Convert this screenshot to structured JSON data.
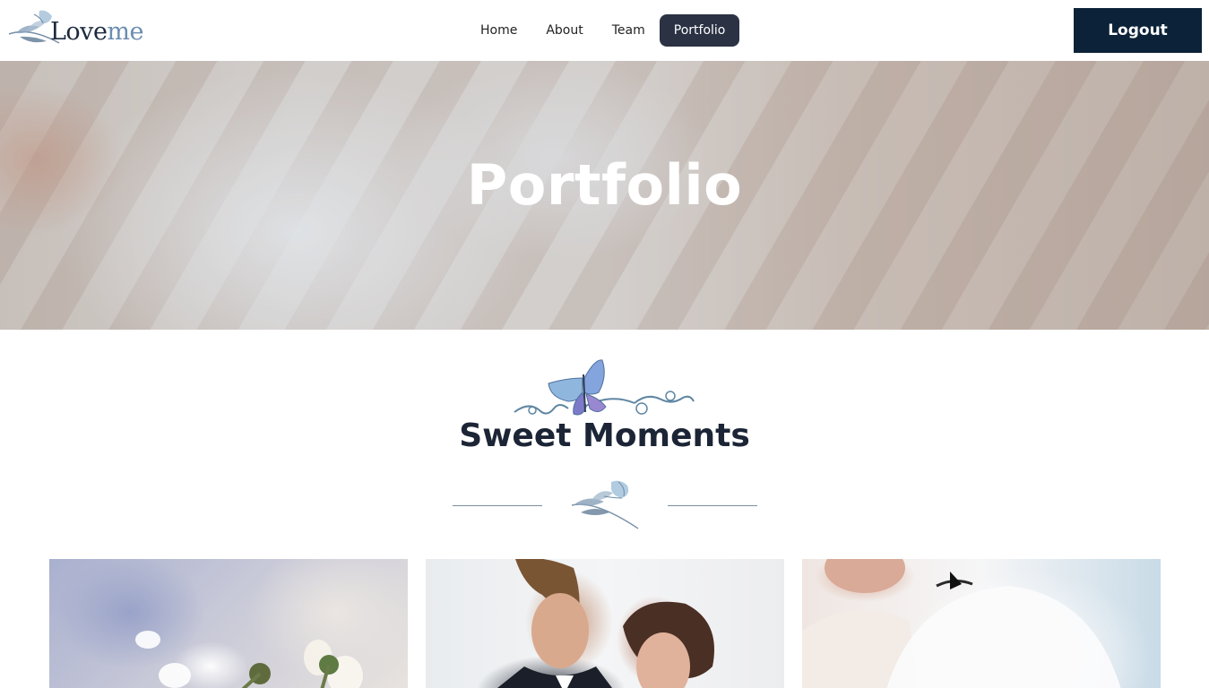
{
  "brand": {
    "name_part1": "Love",
    "name_part2": "me"
  },
  "nav": {
    "items": [
      {
        "label": "Home",
        "active": false
      },
      {
        "label": "About",
        "active": false
      },
      {
        "label": "Team",
        "active": false
      },
      {
        "label": "Portfolio",
        "active": true
      }
    ]
  },
  "header": {
    "logout_label": "Logout"
  },
  "hero": {
    "title": "Portfolio"
  },
  "section": {
    "title": "Sweet Moments"
  },
  "colors": {
    "accent_dark": "#0b2238",
    "nav_active": "#2b3244",
    "heading": "#1c2536",
    "logo_secondary": "#6b8db0"
  }
}
